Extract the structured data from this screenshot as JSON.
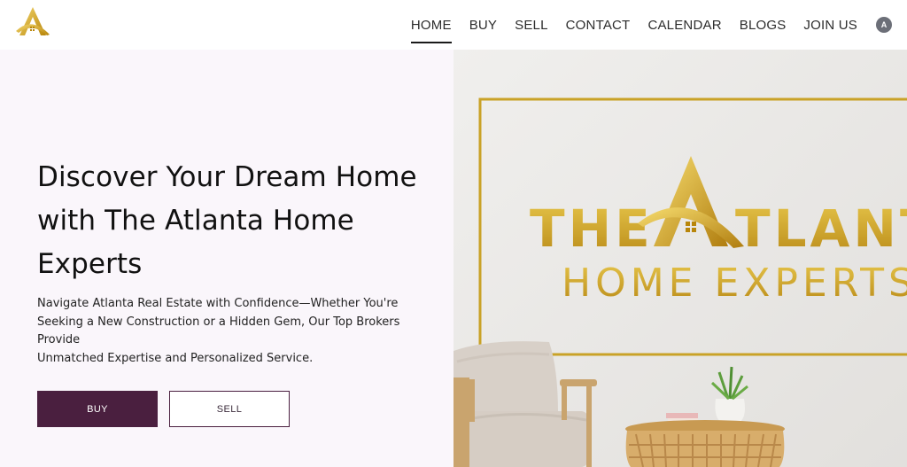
{
  "brand": {
    "logo_icon": "atlanta-home-a-logo",
    "accent_color": "#c9a227"
  },
  "nav": {
    "items": [
      {
        "label": "HOME",
        "active": true
      },
      {
        "label": "BUY"
      },
      {
        "label": "SELL"
      },
      {
        "label": "CONTACT"
      },
      {
        "label": "CALENDAR"
      },
      {
        "label": "BLOGS"
      },
      {
        "label": "JOIN US"
      }
    ],
    "avatar_letter": "A"
  },
  "hero": {
    "title_lines": [
      "Discover Your Dream Home",
      "with The Atlanta Home",
      "Experts"
    ],
    "subtitle_lines": [
      "Navigate Atlanta Real Estate with Confidence—Whether You're",
      "Seeking a New Construction or a Hidden Gem, Our Top Brokers Provide",
      "Unmatched Expertise and Personalized Service."
    ],
    "buy_label": "BUY",
    "sell_label": "SELL",
    "primary_color": "#4a1f3f"
  },
  "image": {
    "sign_line1_left": "THE",
    "sign_line1_right": "TLANT",
    "sign_line2": "HOME EXPERTS"
  }
}
